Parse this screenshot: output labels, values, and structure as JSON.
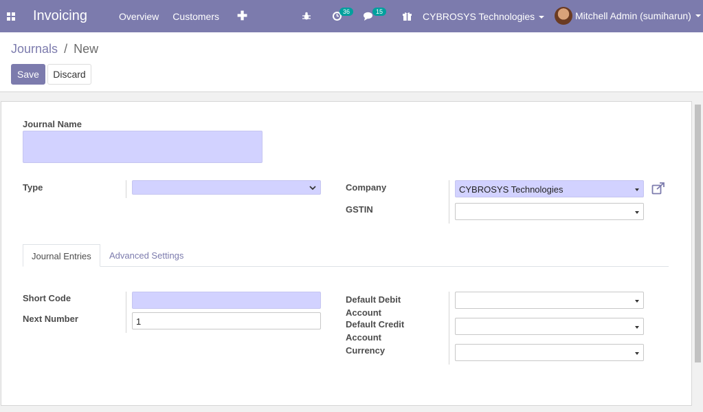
{
  "navbar": {
    "app_name": "Invoicing",
    "menu": [
      "Overview",
      "Customers"
    ],
    "add_icon": "plus-icon",
    "activity_badge": "36",
    "messages_badge": "15",
    "company": "CYBROSYS Technologies",
    "user": "Mitchell Admin (sumiharun)",
    "bg_color": "#7c7bad"
  },
  "breadcrumb": {
    "parent": "Journals",
    "separator": "/",
    "current": "New"
  },
  "buttons": {
    "save": "Save",
    "discard": "Discard"
  },
  "form": {
    "journal_name_label": "Journal Name",
    "journal_name_value": "",
    "type_label": "Type",
    "type_value": "",
    "company_label": "Company",
    "company_value": "CYBROSYS Technologies",
    "gstin_label": "GSTIN",
    "gstin_value": ""
  },
  "tabs": [
    "Journal Entries",
    "Advanced Settings"
  ],
  "entries": {
    "short_code_label": "Short Code",
    "short_code_value": "",
    "next_number_label": "Next Number",
    "next_number_value": "1",
    "default_debit_label": "Default Debit Account",
    "default_credit_label": "Default Credit Account",
    "currency_label": "Currency"
  }
}
